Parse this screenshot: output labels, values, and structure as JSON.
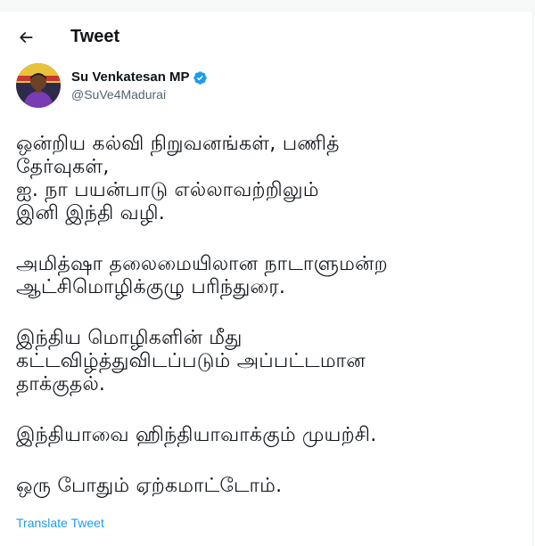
{
  "header": {
    "title": "Tweet",
    "back_icon": "arrow-left-icon"
  },
  "author": {
    "display_name": "Su Venkatesan MP",
    "handle": "@SuVe4Madurai",
    "verified_icon": "verified-badge-icon",
    "verified_color": "#1d9bf0"
  },
  "tweet": {
    "paragraphs": [
      [
        "ஒன்றிய கல்வி நிறுவனங்கள், பணித்",
        "தேர்வுகள்,",
        "ஐ. நா பயன்பாடு எல்லாவற்றிலும்",
        "இனி இந்தி வழி."
      ],
      [
        "அமித்ஷா தலைமையிலான நாடாளுமன்ற",
        "ஆட்சிமொழிக்குழு பரிந்துரை."
      ],
      [
        "இந்திய மொழிகளின் மீது",
        "கட்டவிழ்த்துவிடப்படும் அப்பட்டமான",
        "தாக்குதல்."
      ],
      [
        "இந்தியாவை ஹிந்தியாவாக்கும் முயற்சி."
      ],
      [
        "ஒரு போதும் ஏற்கமாட்டோம்."
      ]
    ]
  },
  "footer": {
    "translate_label": "Translate Tweet"
  },
  "colors": {
    "text": "#0f1419",
    "secondary": "#536471",
    "accent": "#1d9bf0"
  }
}
